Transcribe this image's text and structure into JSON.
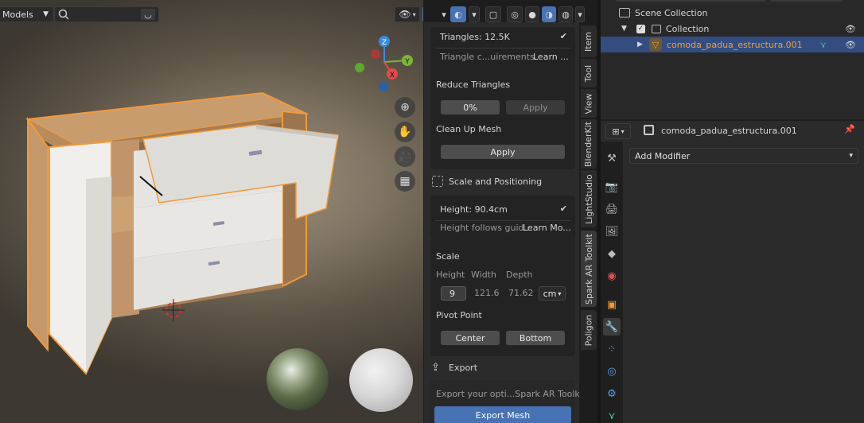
{
  "viewport_header": {
    "mode_label": "Models",
    "search_placeholder": ""
  },
  "npanel": {
    "triangles_label": "Triangles: 12.5K",
    "triangles_hint": "Triangle c...uirements.",
    "triangles_learn": "Learn ...",
    "reduce_title": "Reduce Triangles",
    "reduce_percent": "0%",
    "reduce_apply": "Apply",
    "cleanup_title": "Clean Up Mesh",
    "cleanup_apply": "Apply",
    "scale_section_title": "Scale and Positioning",
    "height_label": "Height: 90.4cm",
    "height_hint": "Height follows guid...",
    "height_learn": "Learn Mo...",
    "scale_title": "Scale",
    "col_height": "Height",
    "col_width": "Width",
    "col_depth": "Depth",
    "val_height": "9",
    "val_width": "121.6",
    "val_depth": "71.62",
    "unit": "cm",
    "pivot_title": "Pivot Point",
    "pivot_center": "Center",
    "pivot_bottom": "Bottom",
    "export_title": "Export",
    "export_hint": "Export your opti...Spark AR Toolkit.",
    "export_button": "Export Mesh"
  },
  "tabs": [
    "Item",
    "Tool",
    "View",
    "BlenderKit",
    "LightStudio",
    "Spark AR Toolkit",
    "Poligon"
  ],
  "outliner": {
    "scene_collection": "Scene Collection",
    "collection": "Collection",
    "object": "comoda_padua_estructura.001"
  },
  "properties": {
    "object_name": "comoda_padua_estructura.001",
    "add_modifier": "Add Modifier"
  },
  "colors": {
    "accent": "#4772b3",
    "selection_outline": "#f29a3a",
    "object_text": "#f0a040"
  }
}
